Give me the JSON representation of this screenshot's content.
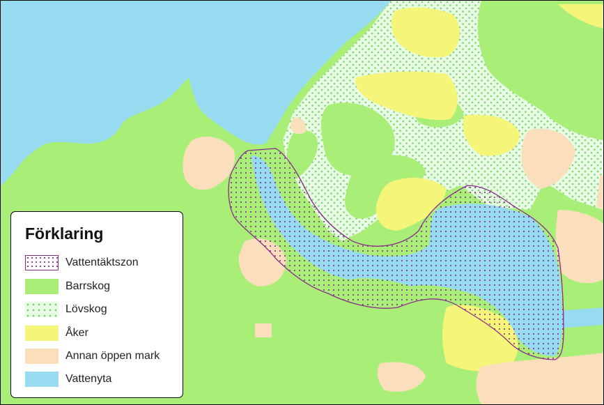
{
  "legend": {
    "title": "Förklaring",
    "items": [
      {
        "label": "Vattentäktszon",
        "fill": "#ffffff",
        "pattern": "vz-dots",
        "border": "#8b2a8b",
        "name": "vattentaktszon"
      },
      {
        "label": "Barrskog",
        "fill": "#a9ee77",
        "name": "barrskog"
      },
      {
        "label": "Lövskog",
        "fill": "#e8fbe4",
        "pattern": "lov-dots",
        "name": "lovskog"
      },
      {
        "label": "Åker",
        "fill": "#f5f57a",
        "name": "aker"
      },
      {
        "label": "Annan öppen mark",
        "fill": "#fbdfbc",
        "name": "annan-oppen-mark"
      },
      {
        "label": "Vattenyta",
        "fill": "#97dbf0",
        "name": "vattenyta"
      }
    ]
  },
  "colors": {
    "barrskog": "#a9ee77",
    "lovskog_bg": "#e8fbe4",
    "lovskog_dot": "#7bd66a",
    "aker": "#f5f57a",
    "annan": "#fbdfbc",
    "vatten": "#97dbf0",
    "zone_border": "#8b2a8b",
    "zone_dot": "#7a1f8a"
  }
}
